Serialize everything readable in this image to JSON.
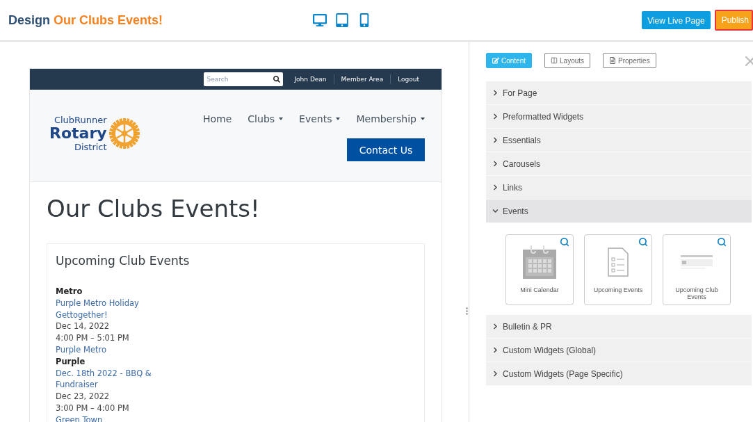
{
  "header": {
    "title_prefix": "Design",
    "title_page": "Our Clubs Events!",
    "buttons": [
      {
        "label": "View Live Page",
        "kind": "live"
      },
      {
        "label": "Publish",
        "kind": "publish"
      }
    ]
  },
  "preview": {
    "top_bar": {
      "search_placeholder": "Search",
      "links": [
        "John Dean",
        "Member Area",
        "Logout"
      ]
    },
    "logo": {
      "line1": "ClubRunner",
      "line2": "Rotary",
      "line3": "District"
    },
    "nav": [
      {
        "label": "Home",
        "dropdown": false
      },
      {
        "label": "Clubs",
        "dropdown": true
      },
      {
        "label": "Events",
        "dropdown": true
      },
      {
        "label": "Membership",
        "dropdown": true
      }
    ],
    "contact_button": "Contact Us",
    "page_title": "Our Clubs Events!",
    "widget": {
      "title": "Upcoming Club Events",
      "lines": [
        {
          "kind": "group",
          "text": "Metro"
        },
        {
          "kind": "link",
          "text": "Purple Metro Holiday Gettogether!"
        },
        {
          "kind": "text",
          "text": "Dec 14, 2022"
        },
        {
          "kind": "text",
          "text": "4:00 PM – 5:01 PM"
        },
        {
          "kind": "link",
          "text": "Purple Metro"
        },
        {
          "kind": "group",
          "text": "Purple"
        },
        {
          "kind": "link",
          "text": "Dec. 18th 2022 - BBQ & Fundraiser"
        },
        {
          "kind": "text",
          "text": "Dec 23, 2022"
        },
        {
          "kind": "text",
          "text": "3:00 PM – 4:00 PM"
        },
        {
          "kind": "link",
          "text": "Green Town"
        }
      ]
    }
  },
  "panel": {
    "tabs": [
      {
        "label": "Content",
        "kind": "content",
        "selected": true
      },
      {
        "label": "Layouts",
        "kind": "layouts",
        "selected": false
      },
      {
        "label": "Properties",
        "kind": "properties",
        "selected": false
      }
    ],
    "sections": [
      {
        "label": "For Page",
        "expanded": false
      },
      {
        "label": "Preformatted Widgets",
        "expanded": false
      },
      {
        "label": "Essentials",
        "expanded": false
      },
      {
        "label": "Carousels",
        "expanded": false
      },
      {
        "label": "Links",
        "expanded": false
      },
      {
        "label": "Events",
        "expanded": true,
        "widgets": [
          {
            "label": "Mini Calendar",
            "kind": "calendar"
          },
          {
            "label": "Upcoming Events",
            "kind": "list"
          },
          {
            "label": "Upcoming Club Events",
            "kind": "club"
          }
        ]
      },
      {
        "label": "Bulletin & PR",
        "expanded": false
      },
      {
        "label": "Custom Widgets (Global)",
        "expanded": false
      },
      {
        "label": "Custom Widgets (Page Specific)",
        "expanded": false
      }
    ]
  }
}
